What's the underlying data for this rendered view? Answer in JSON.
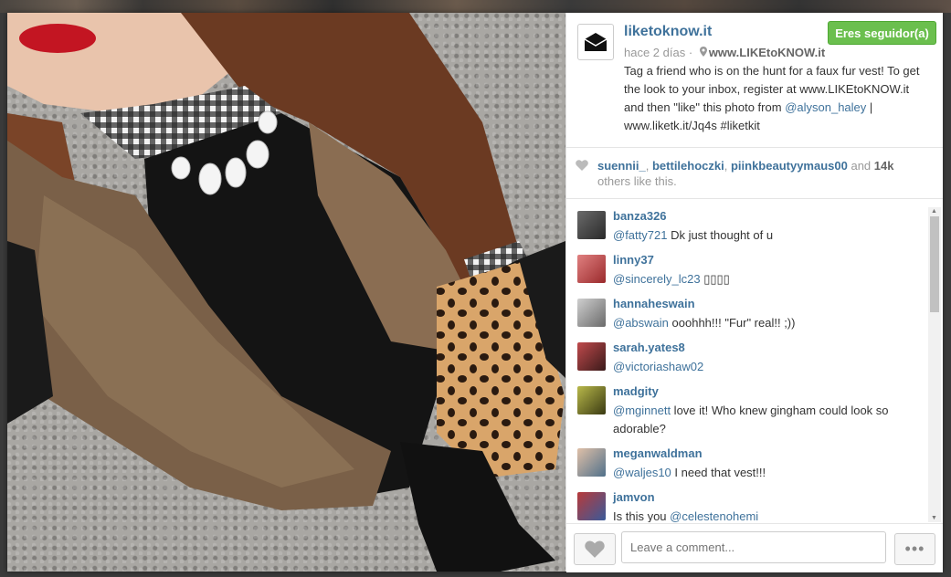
{
  "post": {
    "username": "liketoknow.it",
    "follow_label": "Eres seguidor(a)",
    "time": "hace 2 días",
    "location": "www.LIKEtoKNOW.it",
    "caption_text": "Tag a friend who is on the hunt for a faux fur vest! To get the look to your inbox, register at www.LIKEtoKNOW.it and then \"like\" this photo from",
    "caption_mention": "@alyson_haley",
    "caption_tail": "| www.liketk.it/Jq4s #liketkit"
  },
  "likes": {
    "users": [
      "suennii_",
      "bettilehoczki",
      "piinkbeautyymaus00"
    ],
    "sep1": ", ",
    "and_word": " and ",
    "count": "14k",
    "suffix": "others like this."
  },
  "comments": [
    {
      "user": "banza326",
      "mention": "@fatty721",
      "text": " Dk just thought of u",
      "avatar": "#3a3a3a"
    },
    {
      "user": "linny37",
      "mention": "@sincerely_lc23",
      "text": " ▯▯▯▯",
      "avatar": "#b4484a"
    },
    {
      "user": "hannaheswain",
      "mention": "@abswain",
      "text": " ooohhh!!! \"Fur\" real!! ;))",
      "avatar": "#8c8c8c"
    },
    {
      "user": "sarah.yates8",
      "mention": "@victoriashaw02",
      "text": "",
      "avatar": "#8a2e30"
    },
    {
      "user": "madgity",
      "mention": "@mginnett",
      "text": " love it! Who knew gingham could look so adorable?",
      "avatar": "#7a7a2a"
    },
    {
      "user": "meganwaldman",
      "mention": "@waljes10",
      "text": " I need that vest!!!",
      "avatar": "#6b7f8f"
    },
    {
      "user": "jamvon",
      "mention": "",
      "text": "Is this you ",
      "mention2": "@celestenohemi",
      "avatar": "#4a6a9a"
    }
  ],
  "footer": {
    "comment_placeholder": "Leave a comment...",
    "more_label": "•••"
  },
  "icons": {
    "logo": "envelope-icon",
    "location": "pin-icon",
    "like": "heart-icon",
    "more": "ellipsis-icon"
  }
}
